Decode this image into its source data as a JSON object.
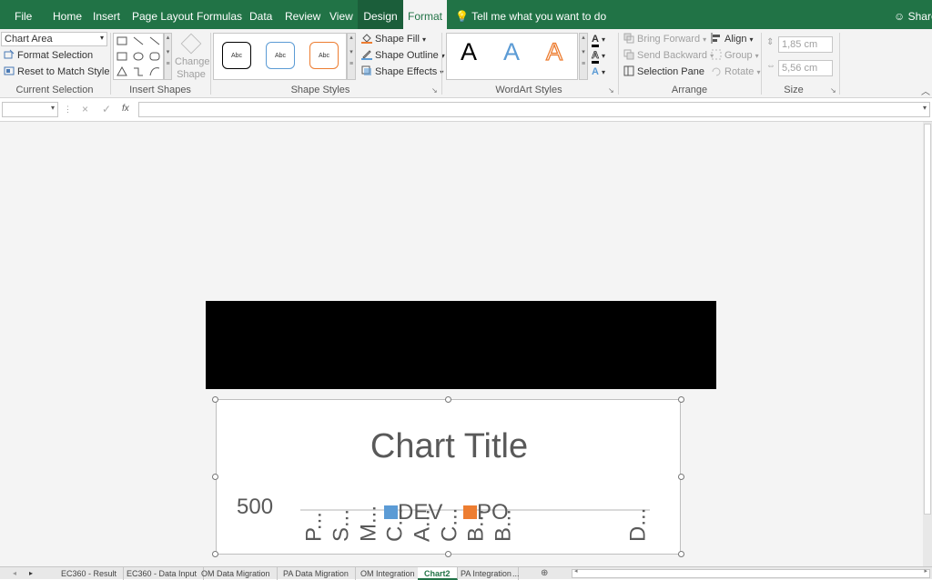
{
  "tabs": {
    "file": "File",
    "home": "Home",
    "insert": "Insert",
    "page_layout": "Page Layout",
    "formulas": "Formulas",
    "data": "Data",
    "review": "Review",
    "view": "View",
    "design": "Design",
    "format": "Format",
    "tell_me": "Tell me what you want to do",
    "share": "Share"
  },
  "current_selection": {
    "dropdown_value": "Chart Area",
    "format_selection": "Format Selection",
    "reset_match_style": "Reset to Match Style",
    "label": "Current Selection"
  },
  "insert_shapes": {
    "change_shape": "Change Shape",
    "label": "Insert Shapes"
  },
  "shape_styles": {
    "sample_text": "Abc",
    "shape_fill": "Shape Fill",
    "shape_outline": "Shape Outline",
    "shape_effects": "Shape Effects",
    "label": "Shape Styles",
    "colors": [
      "#000000",
      "#5b9bd5",
      "#ed7d31"
    ]
  },
  "wordart_styles": {
    "letter": "A",
    "label": "WordArt Styles"
  },
  "arrange": {
    "bring_forward": "Bring Forward",
    "send_backward": "Send Backward",
    "selection_pane": "Selection Pane",
    "align": "Align",
    "group": "Group",
    "rotate": "Rotate",
    "label": "Arrange"
  },
  "size": {
    "height": "1,85 cm",
    "width": "5,56 cm",
    "label": "Size"
  },
  "formula_bar": {
    "fx": "fx",
    "cancel": "×",
    "enter": "✓"
  },
  "chart_data": {
    "type": "bar",
    "title": "Chart Title",
    "y_tick_labels": [
      "500"
    ],
    "categories": [
      "P...",
      "S...",
      "M...",
      "C...",
      "A...",
      "C...",
      "B...",
      "B...",
      "D..."
    ],
    "series": [
      {
        "name": "DEV",
        "color": "#5b9bd5"
      },
      {
        "name": "PO",
        "color": "#ed7d31"
      }
    ],
    "legend_position": "top"
  },
  "sheet_tabs": [
    "EC360 - Result",
    "EC360 - Data Input",
    "OM Data Migration",
    "PA Data Migration",
    "OM Integration",
    "Chart2",
    "PA Integration",
    "..."
  ],
  "active_sheet": "Chart2"
}
